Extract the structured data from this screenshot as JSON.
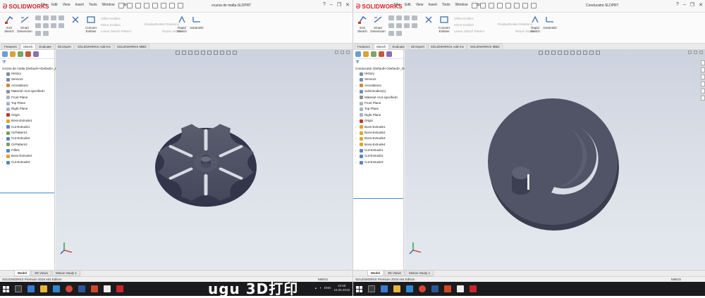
{
  "colors": {
    "accent": "#3e8ed0",
    "brand": "#d71920",
    "part": "#4e5162",
    "taskbar": "#1b1b1d"
  },
  "windows": [
    {
      "title": "cruzsa de malta.SLDPRT",
      "root": "cruzsa de malta (Default<<Default>_D",
      "tree": [
        "History",
        "Sensors",
        "Annotations",
        "Material <not specified>",
        "Front Plane",
        "Top Plane",
        "Right Plane",
        "Origin",
        "Boss-Extrude1",
        "Cut-Extrude1",
        "CirPattern1",
        "Cut-Extrude2",
        "CirPattern2",
        "Fillet1",
        "Boss-Extrude2",
        "Cut-Extrude3"
      ],
      "status_units": "MMGS",
      "taskbar_time": "10:59",
      "taskbar_date": "15.06.2018",
      "taskbar_lang": "ENG"
    },
    {
      "title": "Conducator.SLDPRT",
      "root": "Conducator (Default<<Default>_Displa",
      "tree": [
        "History",
        "Sensors",
        "Annotations",
        "Solid Bodies(1)",
        "Material <not specified>",
        "Front Plane",
        "Top Plane",
        "Right Plane",
        "Origin",
        "Boss-Extrude1",
        "Boss-Extrude2",
        "Boss-Extrude3",
        "Boss-Extrude4",
        "Cut-Extrude1",
        "Cut-Extrude2",
        "Cut-Extrude3"
      ],
      "status_units": "MMGS",
      "taskbar_time": "10:59",
      "taskbar_date": "15.06.2018",
      "taskbar_lang": "ENG"
    }
  ],
  "app": {
    "logo": "SOLIDWORKS",
    "menus": [
      "File",
      "Edit",
      "View",
      "Insert",
      "Tools",
      "Window",
      "Help"
    ],
    "commands": {
      "exit_sketch": "Exit Sketch",
      "smart_dimension": "Smart Dimension",
      "convert_entities": "Convert Entities",
      "rapid_sketch": "Rapid Sketch",
      "instant2d": "Instant2D"
    },
    "greyed": [
      "Offset Entities",
      "Mirror Entities",
      "Linear Sketch Pattern",
      "Move Entities",
      "Display/Delete Relations",
      "Repair Sketch"
    ],
    "tabs": [
      "Features",
      "Sketch",
      "Evaluate",
      "DimXpert",
      "SOLIDWORKS Add-Ins",
      "SOLIDWORKS MBD"
    ],
    "bottom_tabs": [
      "Model",
      "3D Views",
      "Motion Study 1"
    ],
    "status": "SOLIDWORKS Premium 2016 x64 Edition"
  },
  "watermark": "ugu 3D打印"
}
